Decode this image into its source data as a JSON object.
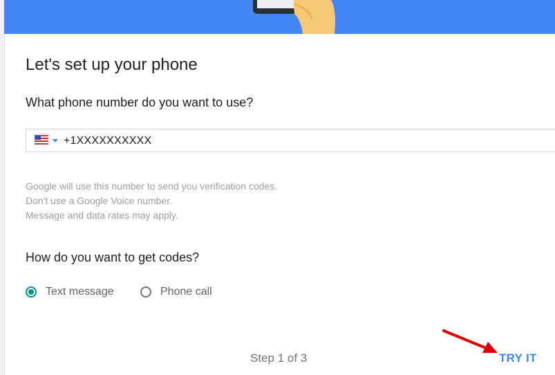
{
  "header": {
    "title": "Let's set up your phone"
  },
  "phone_section": {
    "question": "What phone number do you want to use?",
    "country_flag_icon": "us-flag-icon",
    "dropdown_icon": "caret-down-icon",
    "phone_value": "+1XXXXXXXXXX"
  },
  "help_text": {
    "line1": "Google will use this number to send you verification codes.",
    "line2": "Don't use a Google Voice number.",
    "line3": "Message and data rates may apply."
  },
  "codes_section": {
    "question": "How do you want to get codes?",
    "options": [
      {
        "label": "Text message",
        "selected": true
      },
      {
        "label": "Phone call",
        "selected": false
      }
    ]
  },
  "footer": {
    "step_text": "Step 1 of 3",
    "try_label": "TRY IT"
  },
  "colors": {
    "banner": "#4285f4",
    "accent_radio": "#009688",
    "link": "#4285f4",
    "annotation_arrow": "#e00000"
  }
}
